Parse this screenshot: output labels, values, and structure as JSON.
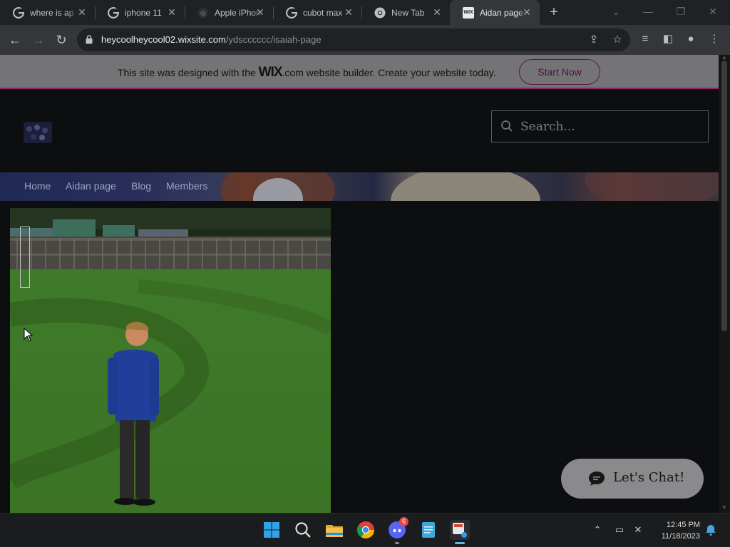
{
  "browser": {
    "tabs": [
      {
        "title": "where is ap",
        "favicon": "google-icon",
        "active": false
      },
      {
        "title": "iphone 11",
        "favicon": "google-icon",
        "active": false
      },
      {
        "title": "Apple iPhon",
        "favicon": "apple-icon",
        "active": false
      },
      {
        "title": "cubot max",
        "favicon": "google-icon",
        "active": false
      },
      {
        "title": "New Tab",
        "favicon": "chrome-icon",
        "active": false
      },
      {
        "title": "Aidan page",
        "favicon": "wix-icon",
        "active": true
      }
    ],
    "address": {
      "host": "heycoolheycool02.wixsite.com",
      "path": "/ydscccccc/isaiah-page"
    }
  },
  "wix_banner": {
    "text_before": "This site was designed with the",
    "brand": "WIX",
    "text_after": ".com website builder. Create your website today.",
    "cta_label": "Start Now"
  },
  "site": {
    "search_placeholder": "Search...",
    "nav": [
      {
        "label": "Home"
      },
      {
        "label": "Aidan page"
      },
      {
        "label": "Blog"
      },
      {
        "label": "Members"
      }
    ],
    "chat_label": "Let's Chat!"
  },
  "taskbar": {
    "apps": [
      "windows-start-icon",
      "search-icon",
      "file-explorer-icon",
      "chrome-icon",
      "discord-icon",
      "notepad-icon",
      "snipping-tool-icon"
    ],
    "discord_badge": "6",
    "time": "12:45 PM",
    "date": "11/18/2023"
  },
  "colors": {
    "accent": "#8a2a6c",
    "page_bg": "#0d0e10",
    "nav_text": "#9aa3c5"
  }
}
